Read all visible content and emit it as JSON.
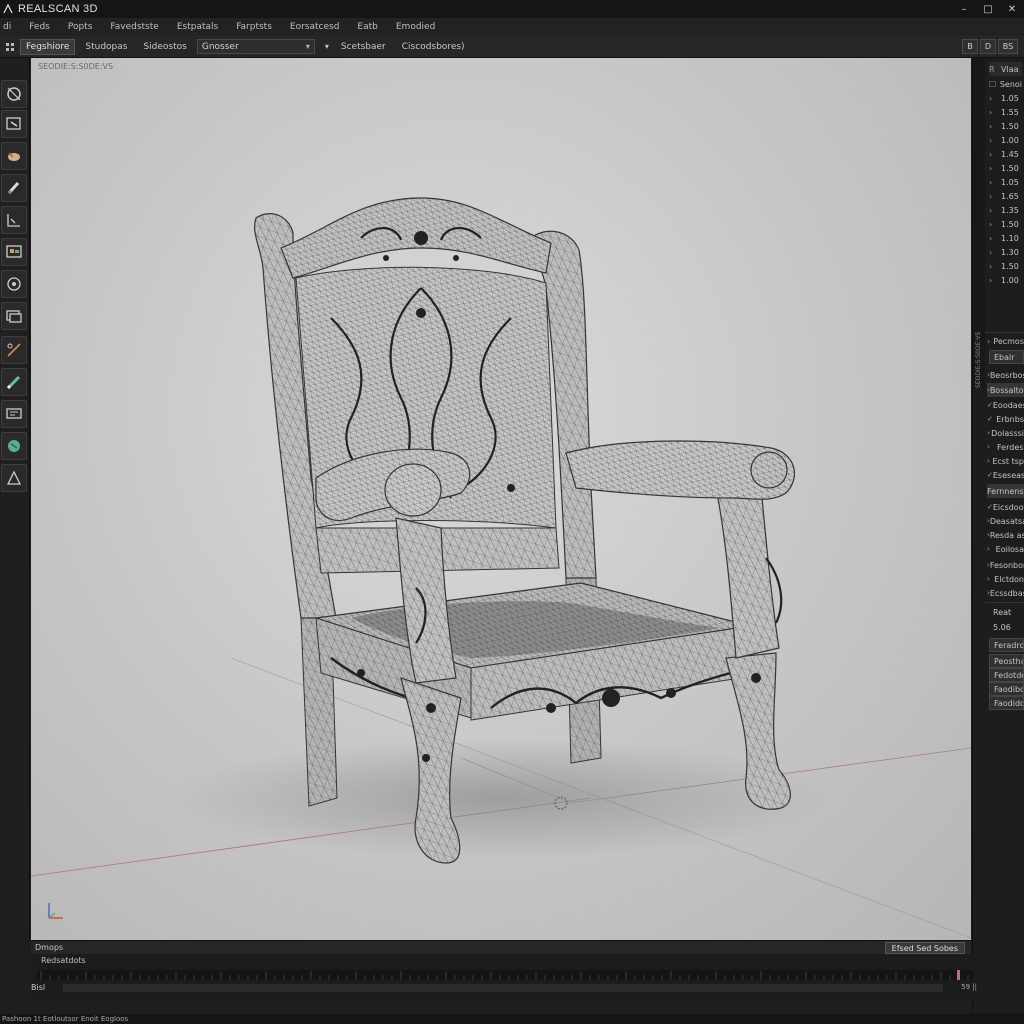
{
  "window": {
    "title": "REALSCAN 3D",
    "controls": [
      "–",
      "□",
      "✕"
    ]
  },
  "menu": [
    "di",
    "Feds",
    "Popts",
    "Favedstste",
    "Estpatals",
    "Farptsts",
    "Eorsatcesd",
    "Eatb",
    "Emodied"
  ],
  "toolbar": {
    "lead_icon": "grid-icon",
    "buttons": [
      "Fegshiore",
      "Studopas",
      "Sideostos"
    ],
    "select_value": "Gnosser",
    "extra": [
      "Scetsbaer",
      "Ciscodsbores)"
    ],
    "right_icons": [
      "B",
      "D",
      "BS"
    ]
  },
  "viewport": {
    "label": "SEODIE:S:S0DE:VS",
    "background": "#cfcfcf",
    "mesh_color": "#3a3a3a"
  },
  "left_tools": [
    "select-icon",
    "camera-icon",
    "hand-icon",
    "brush-icon",
    "measure-icon",
    "texture-icon",
    "orbit-icon",
    "layers-icon",
    "cut-icon",
    "pen-icon",
    "display-icon",
    "material-icon",
    "triangle-icon"
  ],
  "right_panel": {
    "top_rows": [
      {
        "k": "R",
        "v": "Vlaa"
      },
      {
        "k": "",
        "v": "Senoi"
      },
      {
        "k": "",
        "v": "1.05"
      },
      {
        "k": "",
        "v": "1.55"
      },
      {
        "k": "",
        "v": "1.50"
      },
      {
        "k": "",
        "v": "1.00"
      },
      {
        "k": "",
        "v": "1.45"
      },
      {
        "k": "",
        "v": "1.50"
      },
      {
        "k": "",
        "v": "1.05"
      },
      {
        "k": "",
        "v": "1.65"
      },
      {
        "k": "",
        "v": "1.35"
      },
      {
        "k": "",
        "v": "1.50"
      },
      {
        "k": "",
        "v": "1.10"
      },
      {
        "k": "",
        "v": "1.30"
      },
      {
        "k": "",
        "v": "1.50"
      },
      {
        "k": "",
        "v": "1.00"
      }
    ],
    "section_title": "Pecmos",
    "section_sub": "Ebalr",
    "list_items": [
      "Beosrbos",
      "Bossaltos",
      "Eoodaes",
      "Erbnbs",
      "Dolasssi",
      "Ferdes",
      "Ecst tsp",
      "Eseseas",
      "Fernnenst",
      "Eicsdoos",
      "Deasatsa",
      "Resda ass",
      "Eoilosa",
      "Fesonbon",
      "Elctdon",
      "Ecssdbas"
    ],
    "bottom_label": "Reat",
    "bottom_value": "5.06",
    "buttons": [
      "Feradroos",
      "Peosthas",
      "Fedotdeos",
      "Faodibos",
      "Faodidos"
    ]
  },
  "bottom": {
    "label": "Dmops",
    "right_button": "Efsed Sed Sobes"
  },
  "timeline": {
    "label": "Redsatdots",
    "track_label": "Bisl",
    "ctl": "59 ||"
  },
  "status": "Pashoon 1t Eotloutsor   Enoit Eogloos"
}
